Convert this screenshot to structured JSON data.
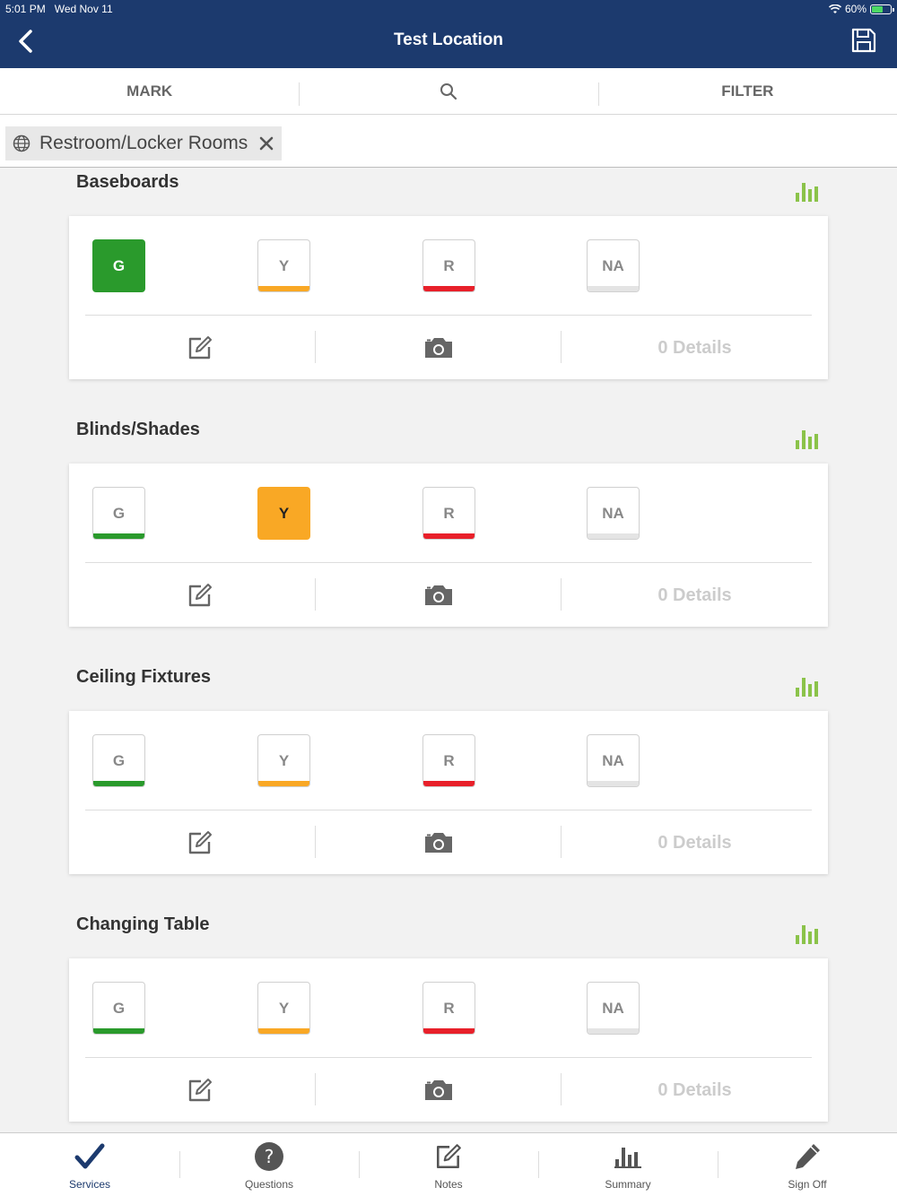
{
  "status": {
    "time": "5:01 PM",
    "date": "Wed Nov 11",
    "battery": "60%",
    "battery_level": 0.6
  },
  "header": {
    "title": "Test Location"
  },
  "segments": {
    "mark": "MARK",
    "filter": "FILTER"
  },
  "filter_chip": {
    "label": "Restroom/Locker Rooms"
  },
  "colors": {
    "nav": "#1c3a6e",
    "green": "#2a9a2c",
    "yellow": "#f9a825",
    "red": "#e8202a",
    "na": "#e4e4e4",
    "chart": "#8bc34a"
  },
  "rating_labels": {
    "g": "G",
    "y": "Y",
    "r": "R",
    "na": "NA"
  },
  "sections": [
    {
      "title": "Baseboards",
      "selected": "G",
      "details": "0 Details"
    },
    {
      "title": "Blinds/Shades",
      "selected": "Y",
      "details": "0 Details"
    },
    {
      "title": "Ceiling Fixtures",
      "selected": "",
      "details": "0 Details"
    },
    {
      "title": "Changing Table",
      "selected": "",
      "details": "0 Details"
    }
  ],
  "tabs": [
    {
      "label": "Services",
      "icon": "checkmark-icon",
      "active": true
    },
    {
      "label": "Questions",
      "icon": "question-icon",
      "active": false
    },
    {
      "label": "Notes",
      "icon": "notes-icon",
      "active": false
    },
    {
      "label": "Summary",
      "icon": "bar-chart-icon",
      "active": false
    },
    {
      "label": "Sign Off",
      "icon": "pen-icon",
      "active": false
    }
  ]
}
